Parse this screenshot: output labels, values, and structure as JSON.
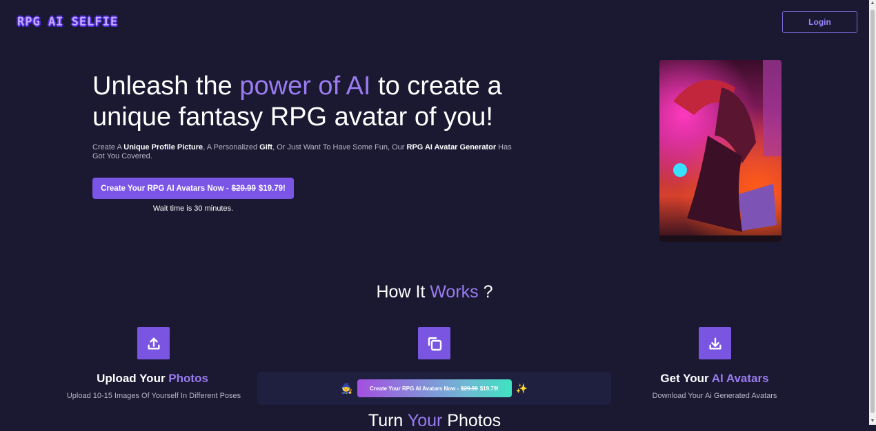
{
  "header": {
    "logo_text": "RPG AI SELFIE",
    "login_label": "Login"
  },
  "hero": {
    "title_part1": "Unleash the ",
    "title_accent": "power of AI",
    "title_part2": " to create a unique fantasy RPG avatar of you!",
    "subtitle": {
      "t1": "Create A ",
      "b1": "Unique Profile Picture",
      "t2": ", A Personalized ",
      "b2": "Gift",
      "t3": ", Or Just Want To Have Some Fun, Our ",
      "b3": "RPG AI Avatar Generator",
      "t4": " Has Got You Covered."
    },
    "cta_prefix": "Create Your RPG AI Avatars Now - ",
    "cta_old_price": "$29.99",
    "cta_new_price": "$19.79!",
    "wait_text": "Wait time is 30 minutes.",
    "image_icon": "dragon-laptop-image"
  },
  "how_it_works": {
    "title_part1": "How It ",
    "title_accent": "Works",
    "title_part2": " ?",
    "steps": [
      {
        "icon": "upload-icon",
        "title_part1": "Upload Your ",
        "title_accent": "Photos",
        "desc": "Upload 10-15 Images Of Yourself In Different Poses"
      },
      {
        "icon": "copy-icon"
      },
      {
        "icon": "download-icon",
        "title_part1": "Get Your ",
        "title_accent": "AI Avatars",
        "desc": "Download Your Ai Generated Avatars"
      }
    ]
  },
  "banner": {
    "left_emoji": "🧙",
    "cta_prefix": "Create Your RPG AI Avatars Now - ",
    "cta_old_price": "$29.99",
    "cta_new_price": "$19.79!",
    "right_emoji": "✨"
  },
  "next_section": {
    "title_part1": "Turn ",
    "title_accent": "Your",
    "title_part2": " Photos"
  },
  "colors": {
    "background": "#1b1932",
    "accent": "#9a7cf0",
    "button": "#7b55e6"
  }
}
